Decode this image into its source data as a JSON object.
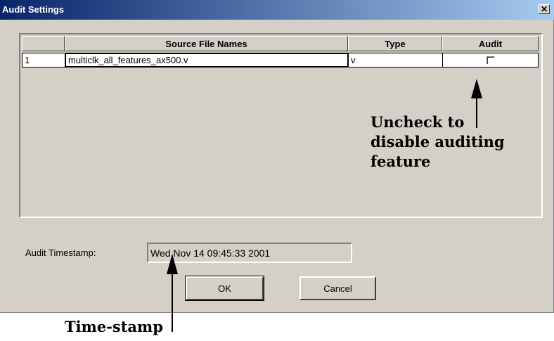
{
  "window": {
    "title": "Audit Settings",
    "close_glyph": "✕"
  },
  "grid": {
    "columns": [
      "",
      "Source File Names",
      "Type",
      "Audit"
    ],
    "rows": [
      {
        "index": "1",
        "file": "multiclk_all_features_ax500.v",
        "type": "v",
        "audit_checked": false
      }
    ]
  },
  "timestamp": {
    "label": "Audit Timestamp:",
    "value": "Wed Nov 14 09:45:33 2001"
  },
  "buttons": {
    "ok": "OK",
    "cancel": "Cancel"
  },
  "annotations": {
    "audit_note_line1": "Uncheck to",
    "audit_note_line2": "disable auditing",
    "audit_note_line3": "feature",
    "timestamp_note": "Time-stamp"
  },
  "colors": {
    "title_bar_start": "#0a246a",
    "title_bar_end": "#a6caf0",
    "dialog_face": "#d4d0c8"
  }
}
